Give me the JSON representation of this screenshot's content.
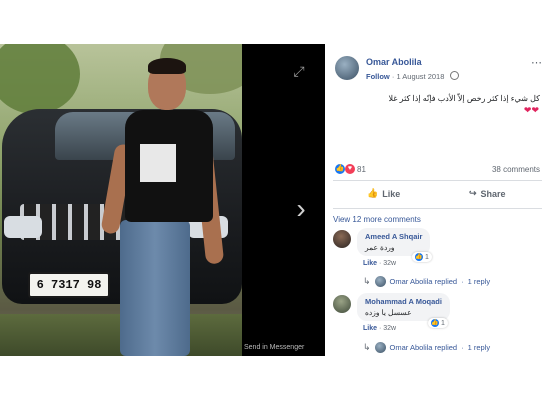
{
  "photo": {
    "plate_text": "6 7317 98",
    "caption": "Send in Messenger"
  },
  "post": {
    "author": "Omar Abolila",
    "follow_label": "Follow",
    "separator": "·",
    "date": "1 August 2018",
    "more_icon": "⋯",
    "text": "كل شيء إذا كثر رخص إلاّ الأدب فإنّه إذا كثر غلا",
    "hearts": "❤❤",
    "reaction_count": "81",
    "comments_count": "38 comments",
    "like_label": "Like",
    "share_label": "Share"
  },
  "comments_section": {
    "view_more": "View 12 more comments",
    "comments": [
      {
        "author": "Ameed A Shqair",
        "text": "وردة عمر",
        "reaction_count": "1",
        "like_label": "Like",
        "separator": "·",
        "time": "32w",
        "replied_by": "Omar Abolila replied",
        "reply_count": "1 reply"
      },
      {
        "author": "Mohammad A Moqadi",
        "text": "عسسل يا وزده",
        "reaction_count": "1",
        "like_label": "Like",
        "separator": "·",
        "time": "32w",
        "replied_by": "Omar Abolila replied",
        "reply_count": "1 reply"
      }
    ]
  },
  "colors": {
    "link_blue": "#385898",
    "like_blue": "#1877f2",
    "love_red": "#f33e58",
    "muted_gray": "#606770"
  }
}
